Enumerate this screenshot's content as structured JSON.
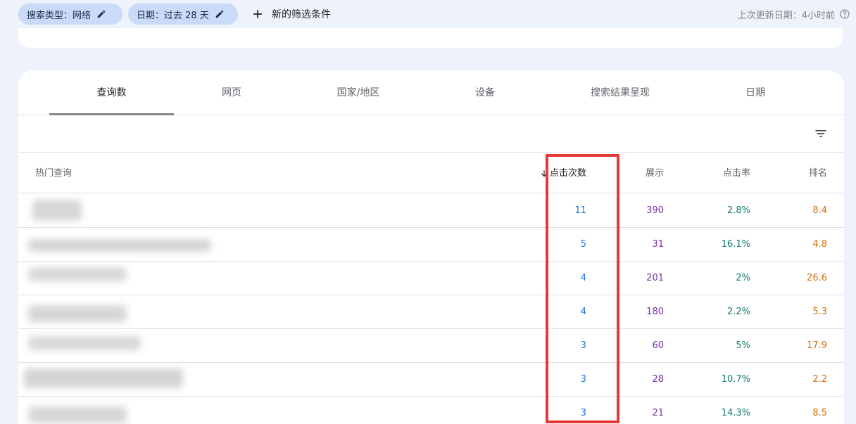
{
  "filters": {
    "search_type_chip": "搜索类型：网络",
    "date_chip": "日期：过去 28 天",
    "add_filter_label": "新的筛选条件",
    "last_updated": "上次更新日期：4小时前"
  },
  "tabs": [
    "查询数",
    "网页",
    "国家/地区",
    "设备",
    "搜索结果呈现",
    "日期"
  ],
  "table": {
    "headers": {
      "query": "热门查询",
      "clicks": "点击次数",
      "impressions": "展示",
      "ctr": "点击率",
      "position": "排名"
    },
    "rows": [
      {
        "clicks": "11",
        "impressions": "390",
        "ctr": "2.8%",
        "position": "8.4"
      },
      {
        "clicks": "5",
        "impressions": "31",
        "ctr": "16.1%",
        "position": "4.8"
      },
      {
        "clicks": "4",
        "impressions": "201",
        "ctr": "2%",
        "position": "26.6"
      },
      {
        "clicks": "4",
        "impressions": "180",
        "ctr": "2.2%",
        "position": "5.3"
      },
      {
        "clicks": "3",
        "impressions": "60",
        "ctr": "5%",
        "position": "17.9"
      },
      {
        "clicks": "3",
        "impressions": "28",
        "ctr": "10.7%",
        "position": "2.2"
      },
      {
        "clicks": "3",
        "impressions": "21",
        "ctr": "14.3%",
        "position": "8.5"
      }
    ]
  },
  "colors": {
    "clicks": "#1a73e8",
    "impressions": "#7b2fa8",
    "ctr": "#137d6a",
    "position": "#d56e0c",
    "highlight_box": "#e53935"
  },
  "icons": [
    "edit-icon",
    "add-icon",
    "help-icon",
    "filter-icon",
    "arrow-down-icon"
  ]
}
